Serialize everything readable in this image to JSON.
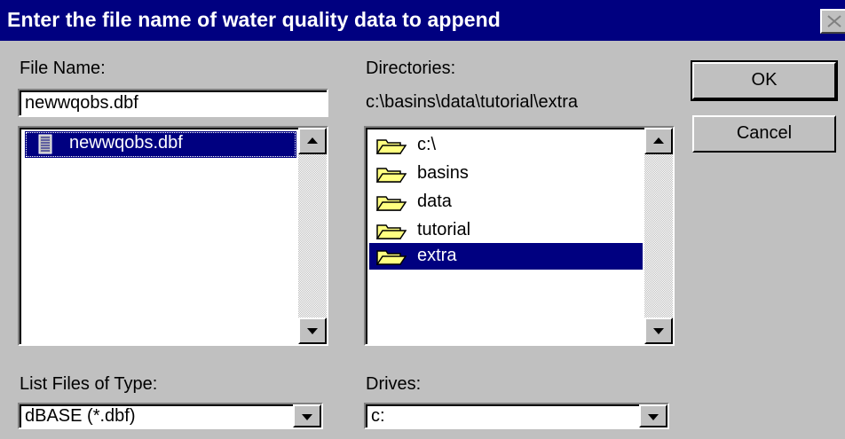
{
  "window": {
    "title": "Enter the file name of water quality data to append"
  },
  "file_name": {
    "label": "File Name:",
    "value": "newwqobs.dbf",
    "files": [
      {
        "name": "newwqobs.dbf",
        "selected": true
      }
    ]
  },
  "directories": {
    "label": "Directories:",
    "current_path": "c:\\basins\\data\\tutorial\\extra",
    "items": [
      {
        "name": "c:\\",
        "icon": "open-folder-icon",
        "selected": false
      },
      {
        "name": "basins",
        "icon": "open-folder-icon",
        "selected": false
      },
      {
        "name": "data",
        "icon": "open-folder-icon",
        "selected": false
      },
      {
        "name": "tutorial",
        "icon": "open-folder-icon",
        "selected": false
      },
      {
        "name": "extra",
        "icon": "open-folder-icon",
        "selected": true
      }
    ]
  },
  "buttons": {
    "ok": "OK",
    "cancel": "Cancel"
  },
  "file_type": {
    "label": "List Files of Type:",
    "selected": "dBASE (*.dbf)"
  },
  "drives": {
    "label": "Drives:",
    "selected": "c:"
  },
  "colors": {
    "title_bar": "#000080",
    "selection": "#000080",
    "face": "#c0c0c0",
    "folder": "#ffff80"
  }
}
